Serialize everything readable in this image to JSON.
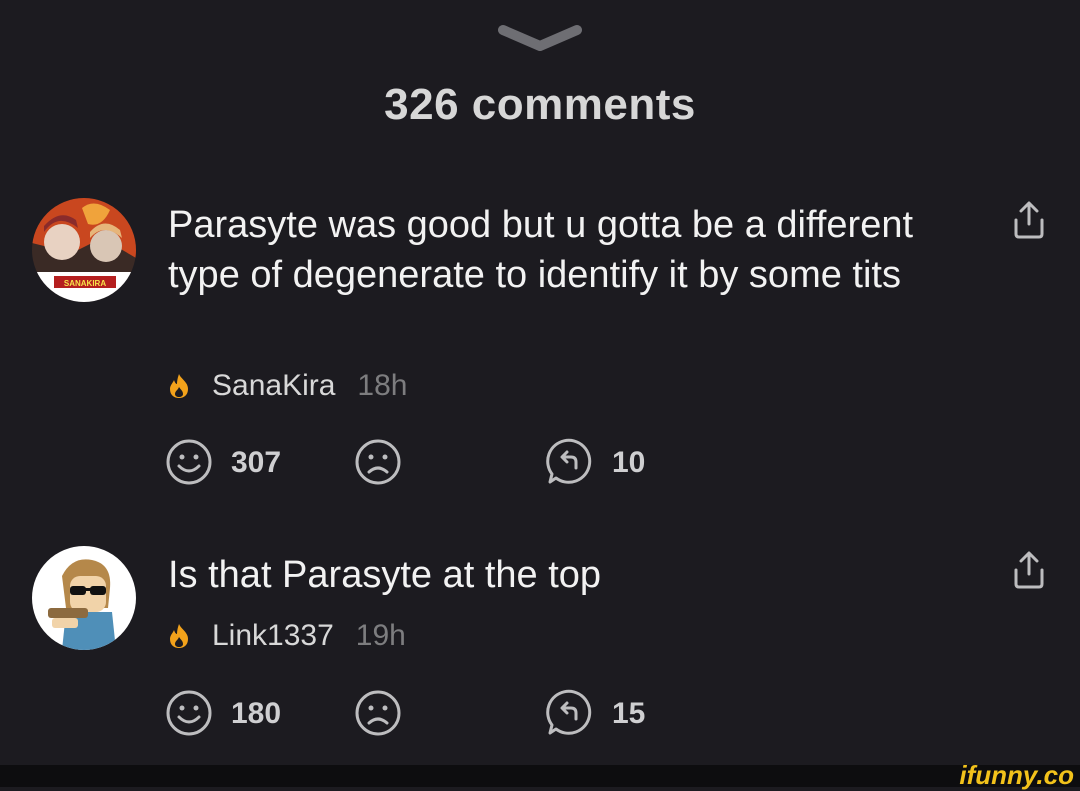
{
  "header": {
    "title": "326 comments"
  },
  "comments": [
    {
      "text": "Parasyte was good but u gotta be a different type of degenerate to identify it by some tits",
      "username": "SanaKira",
      "time": "18h",
      "likes": "307",
      "replies": "10",
      "avatar_label": "SANAKIRA"
    },
    {
      "text": "Is that Parasyte at the top",
      "username": "Link1337",
      "time": "19h",
      "likes": "180",
      "replies": "15"
    }
  ],
  "watermark": "ifunny.co",
  "colors": {
    "background": "#1c1b20",
    "flame": "#f2a21b",
    "icon": "#bdbdbf",
    "watermark": "#f2c21b"
  },
  "icons": [
    "chevron-down-icon",
    "share-icon",
    "flame-icon",
    "smile-icon",
    "frown-icon",
    "reply-icon"
  ]
}
